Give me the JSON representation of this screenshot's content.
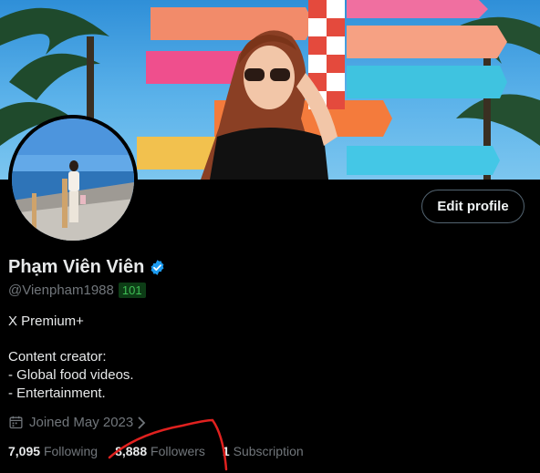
{
  "profile": {
    "display_name": "Phạm Viên Viên",
    "handle": "@Vienpham1988",
    "handle_badge": "101",
    "edit_button_label": "Edit profile",
    "premium_line": "X Premium+",
    "bio_lines": [
      "Content creator:",
      "- Global food videos.",
      "- Entertainment."
    ],
    "joined": "Joined May 2023",
    "stats": {
      "following_count": "7,095",
      "following_label": "Following",
      "followers_count": "8,888",
      "followers_label": "Followers",
      "subscription_count": "1",
      "subscription_label": "Subscription"
    }
  },
  "icons": {
    "verified": "verified-badge-icon",
    "calendar": "calendar-icon",
    "chevron": "chevron-right-icon"
  },
  "colors": {
    "background": "#000000",
    "verified_blue": "#1d9bf0",
    "muted_text": "#71767b",
    "annotation_red": "#e0211f",
    "badge_green": "#3fbf55"
  }
}
